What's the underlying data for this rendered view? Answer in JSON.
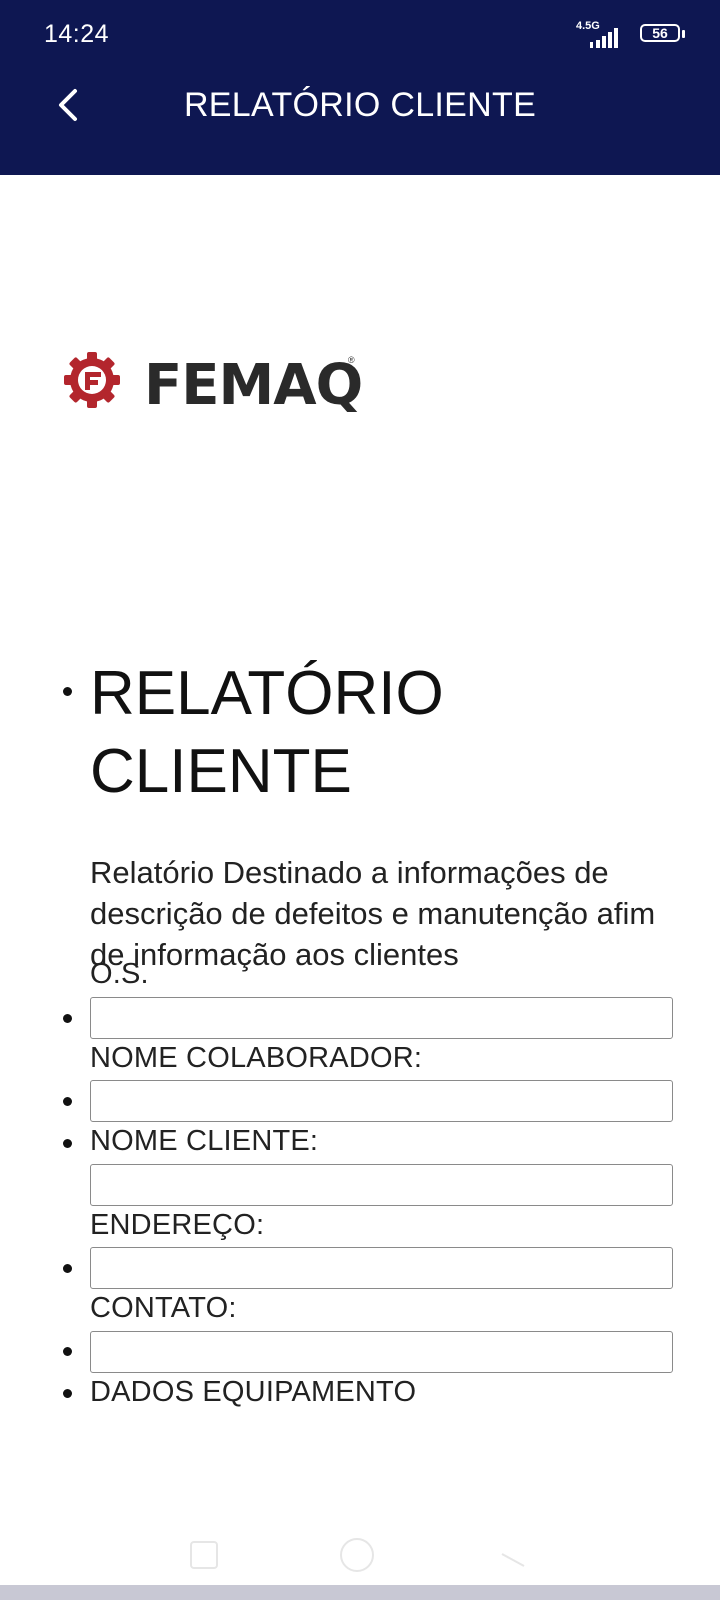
{
  "status_bar": {
    "time": "14:24",
    "network": "4.5G",
    "battery": "56"
  },
  "header": {
    "title": "RELATÓRIO CLIENTE",
    "back_icon": "chevron-left-icon"
  },
  "logo": {
    "brand": "FEMAQ",
    "registered": "®",
    "mark_color": "#b3262d"
  },
  "content": {
    "title_line1": "RELATÓRIO",
    "title_line2": "CLIENTE",
    "description": "Relatório Destinado a informações de descrição de defeitos e manutenção afim de informação aos clientes",
    "fields": [
      {
        "label": "O.S.",
        "value": ""
      },
      {
        "label": "NOME COLABORADOR:",
        "value": ""
      },
      {
        "label": "NOME CLIENTE:",
        "value": ""
      },
      {
        "label": "ENDEREÇO:",
        "value": ""
      },
      {
        "label": "CONTATO:",
        "value": ""
      }
    ],
    "last_item": "DADOS EQUIPAMENTO"
  },
  "colors": {
    "header_bg": "#0e1752",
    "text": "#111111"
  }
}
